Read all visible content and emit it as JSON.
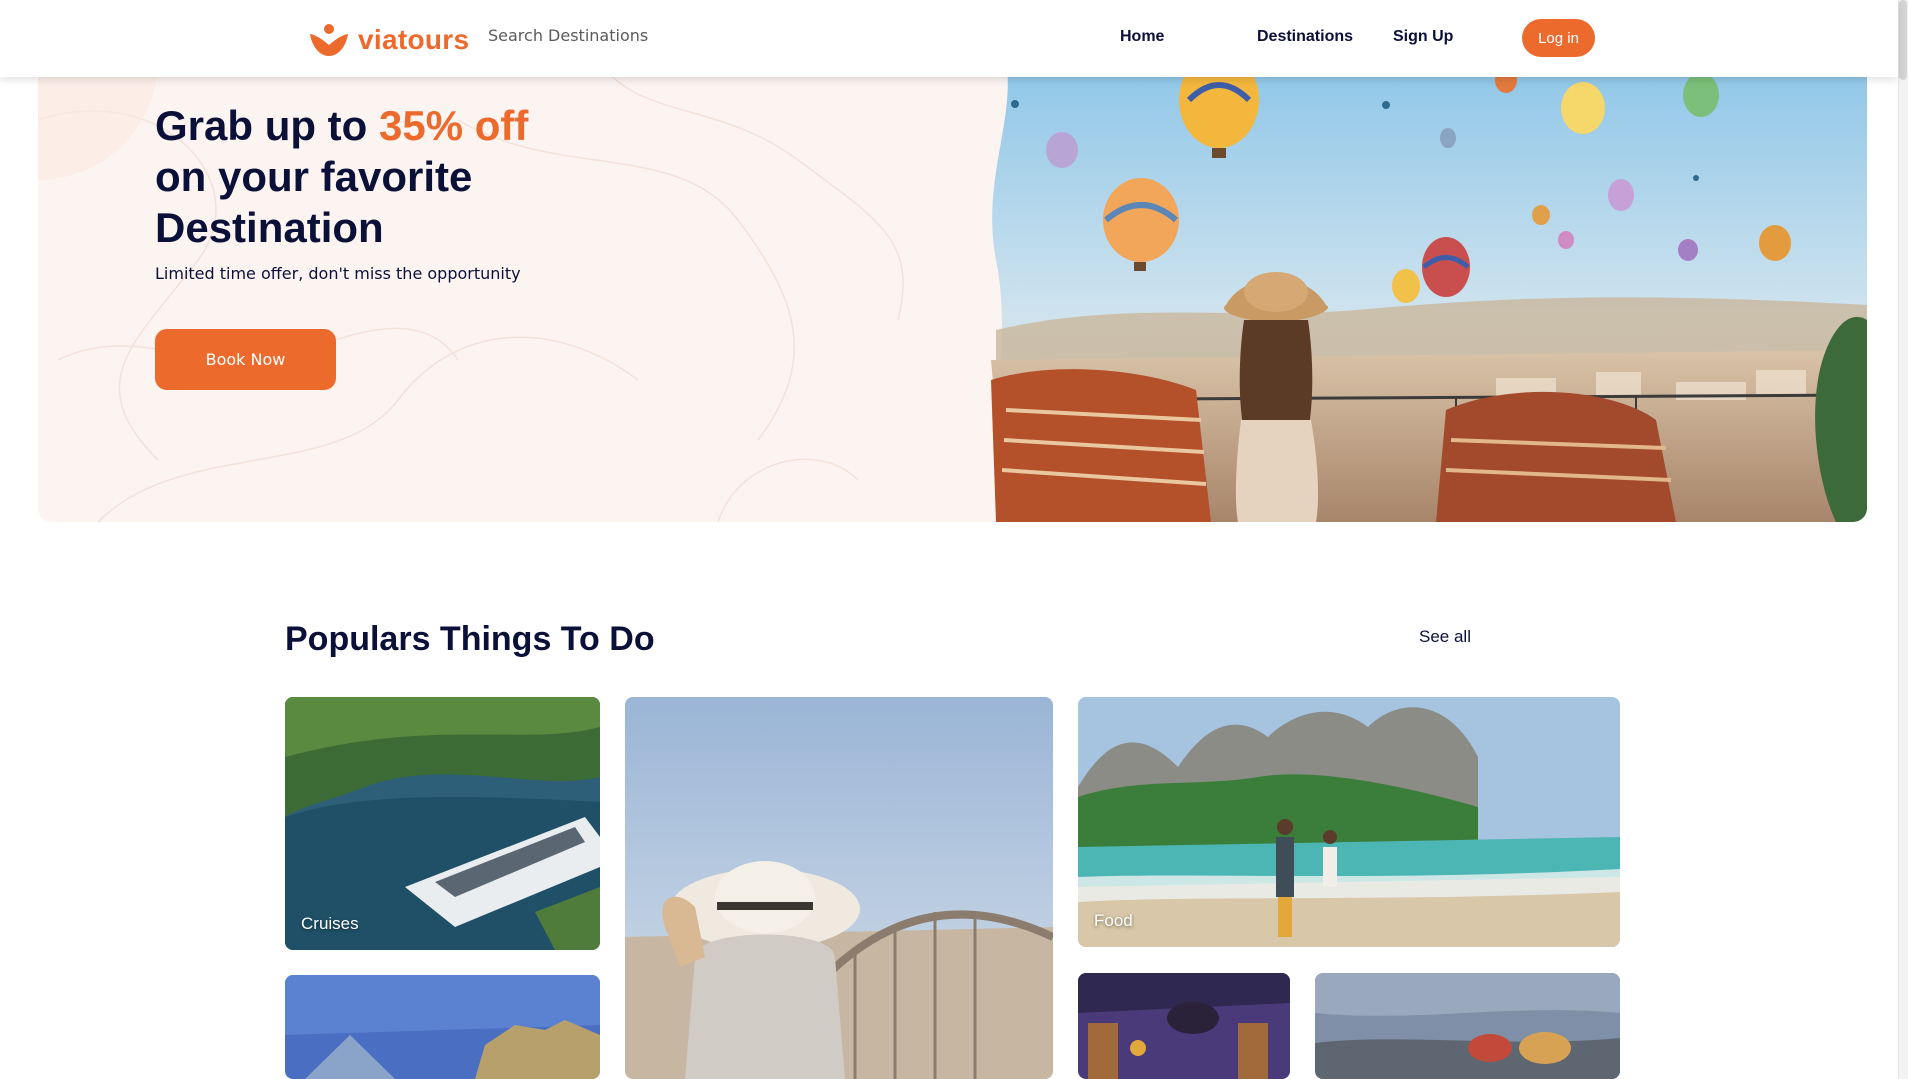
{
  "brand": {
    "name": "viatours",
    "color": "#eb6a2c"
  },
  "header": {
    "search_placeholder": "Search Destinations",
    "nav": {
      "home": "Home",
      "destinations": "Destinations",
      "signup": "Sign Up"
    },
    "login_label": "Log in"
  },
  "hero": {
    "title_prefix": "Grab up to ",
    "title_accent": "35% off",
    "title_line2": "on your favorite",
    "title_line3": "Destination",
    "subtitle": "Limited time offer, don't miss the opportunity",
    "cta_label": "Book Now",
    "image_icon": "hot-air-balloons-photo"
  },
  "section": {
    "title": "Populars Things To Do",
    "see_all": "See all",
    "cards": [
      {
        "label": "Cruises",
        "image_icon": "cruise-ship-photo"
      },
      {
        "label": "",
        "image_icon": "traveler-bridge-photo"
      },
      {
        "label": "Food",
        "image_icon": "beach-couple-photo"
      },
      {
        "label": "",
        "image_icon": "louvre-pyramid-photo"
      },
      {
        "label": "",
        "image_icon": "ornate-interior-photo"
      },
      {
        "label": "",
        "image_icon": "travelers-hats-photo"
      }
    ]
  }
}
